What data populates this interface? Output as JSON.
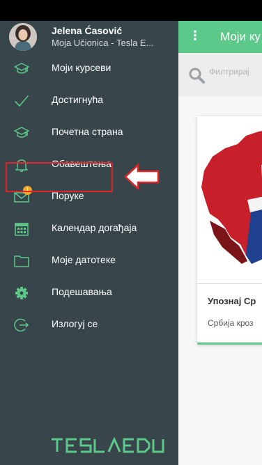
{
  "colors": {
    "drawer_bg": "#38454a",
    "accent_green": "#5cc98a",
    "highlight_red": "#e0262b",
    "badge_orange": "#f5a623"
  },
  "profile": {
    "name": "Jelena Ćasović",
    "subtitle": "Moja Učionica - Tesla E..."
  },
  "nav": [
    {
      "label": "Моји курсеви",
      "icon": "graduation-cap-icon"
    },
    {
      "label": "Достигнућа",
      "icon": "checkmark-icon"
    },
    {
      "label": "Почетна страна",
      "icon": "graduation-cap-icon"
    },
    {
      "label": "Обавештења",
      "icon": "bell-icon"
    },
    {
      "label": "Поруке",
      "icon": "envelope-icon",
      "badge": "!"
    },
    {
      "label": "Календар догађаја",
      "icon": "calendar-icon"
    },
    {
      "label": "Моје датотеке",
      "icon": "folder-icon"
    },
    {
      "label": "Подешавања",
      "icon": "gear-icon"
    },
    {
      "label": "Излогуј се",
      "icon": "logout-icon"
    }
  ],
  "brand": {
    "logo_text": "TESLAEDU"
  },
  "main": {
    "title": "Моји ку",
    "search_placeholder": "Филтрирај",
    "card": {
      "title": "Упознај Ср",
      "subtitle": "Србија кроз"
    }
  }
}
